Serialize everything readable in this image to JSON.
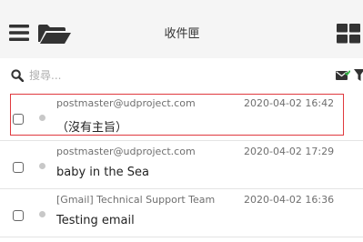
{
  "header": {
    "title": "收件匣",
    "menu_icon": "hamburger-menu-icon",
    "folder_icon": "open-folder-icon",
    "grid_icon": "grid-view-icon"
  },
  "search": {
    "placeholder": "搜尋...",
    "value": "",
    "icon": "search-icon",
    "right_icons": [
      "mail-check-icon",
      "filter-icon"
    ]
  },
  "emails": [
    {
      "sender": "postmaster@udproject.com",
      "date": "2020-04-02 16:42",
      "subject": "（沒有主旨）",
      "highlighted": true
    },
    {
      "sender": "postmaster@udproject.com",
      "date": "2020-04-02 17:29",
      "subject": "baby in the Sea",
      "highlighted": false
    },
    {
      "sender": "[Gmail] Technical Support Team",
      "date": "2020-04-02 16:36",
      "subject": "Testing email",
      "highlighted": false
    }
  ],
  "colors": {
    "header_bg": "#f5f5f5",
    "icon": "#333333",
    "highlight_border": "#e0393e",
    "unread_dot": "#c8c8c8",
    "mail_check_accent": "#2fb344"
  }
}
